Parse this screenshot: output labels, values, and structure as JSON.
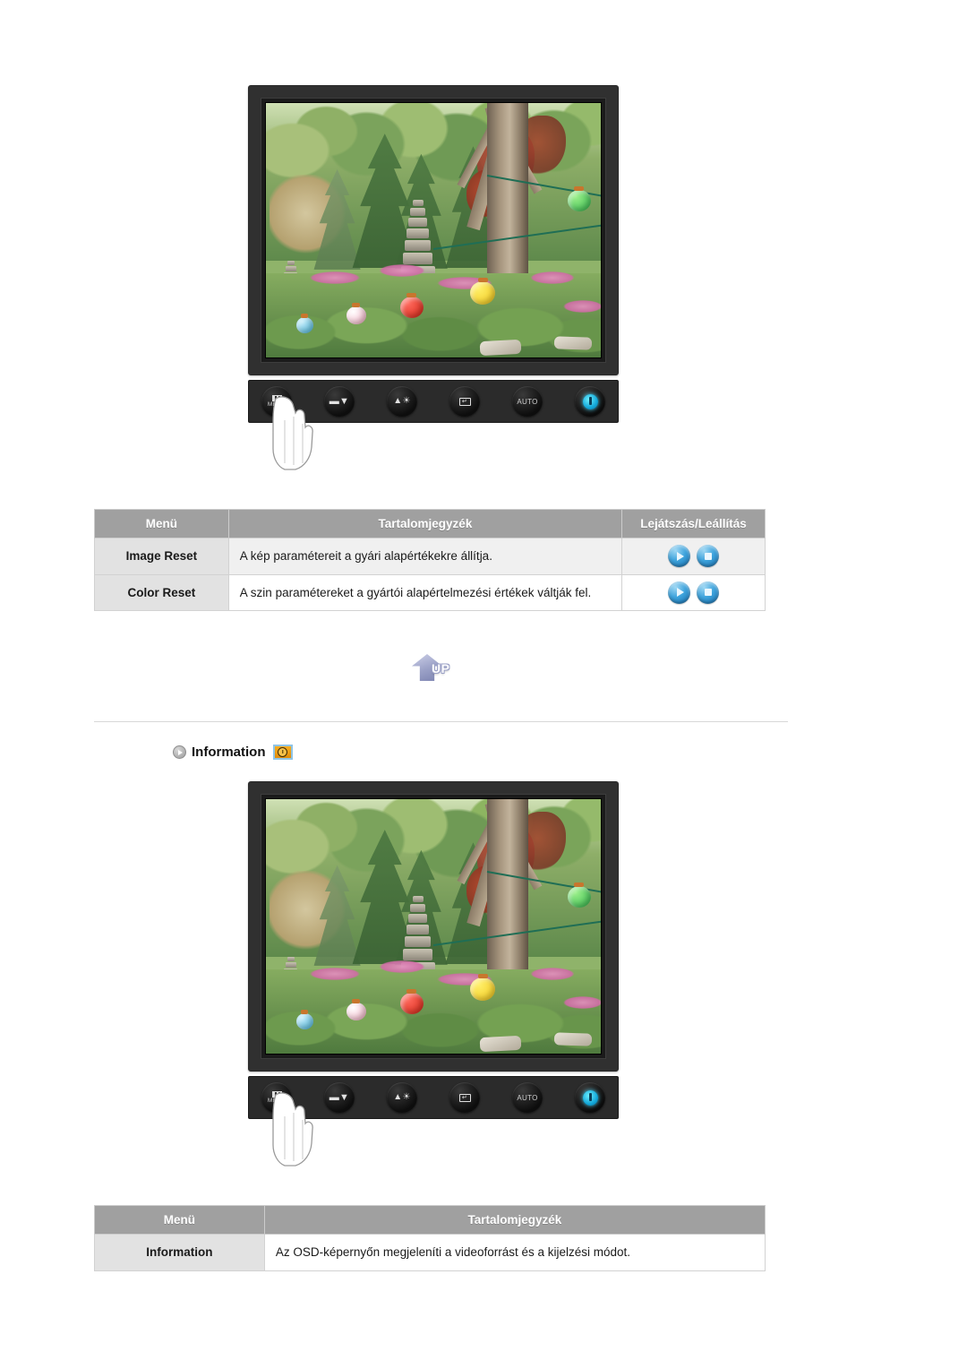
{
  "top_monitor": {
    "label": "monitor-illustration",
    "screen_scene": "Korean garden with stone pagoda, trees and colored paper lanterns",
    "controls": [
      {
        "name": "menu-button",
        "caption": "MENU",
        "glyph": "bars"
      },
      {
        "name": "down-button",
        "caption": "",
        "glyph": "▼"
      },
      {
        "name": "brightness-button",
        "caption": "",
        "glyph": "☀"
      },
      {
        "name": "enter-button",
        "caption": "",
        "glyph": "↵"
      },
      {
        "name": "auto-button",
        "caption": "AUTO",
        "glyph": ""
      },
      {
        "name": "power-button",
        "caption": "",
        "glyph": "power"
      }
    ]
  },
  "table_reset": {
    "headers": [
      "Menü",
      "Tartalomjegyzék",
      "Lejátszás/Leállítás"
    ],
    "rows": [
      {
        "menu": "Image Reset",
        "description": "A kép paramétereit a gyári alapértékekre állítja.",
        "actions": [
          "play",
          "stop"
        ]
      },
      {
        "menu": "Color Reset",
        "description": "A szin paramétereket a gyártói alapértelmezési értékek váltják fel.",
        "actions": [
          "play",
          "stop"
        ]
      }
    ]
  },
  "up_button": {
    "label": "UP"
  },
  "information_section": {
    "heading": "Information"
  },
  "bottom_monitor": {
    "label": "monitor-illustration",
    "screen_scene": "Korean garden with stone pagoda, trees and colored paper lanterns"
  },
  "table_information": {
    "headers": [
      "Menü",
      "Tartalomjegyzék"
    ],
    "rows": [
      {
        "menu": "Information",
        "description": "Az OSD-képernyőn megjeleníti a videoforrást és a kijelzési módot."
      }
    ]
  },
  "colors": {
    "header_gray": "#a0a0a0",
    "menu_cell_gray": "#e2e2e2",
    "alt_row": "#f0f0f0",
    "bezel": "#303030",
    "power_accent": "#12a7d8",
    "badge_orange": "#f6ad1f"
  }
}
